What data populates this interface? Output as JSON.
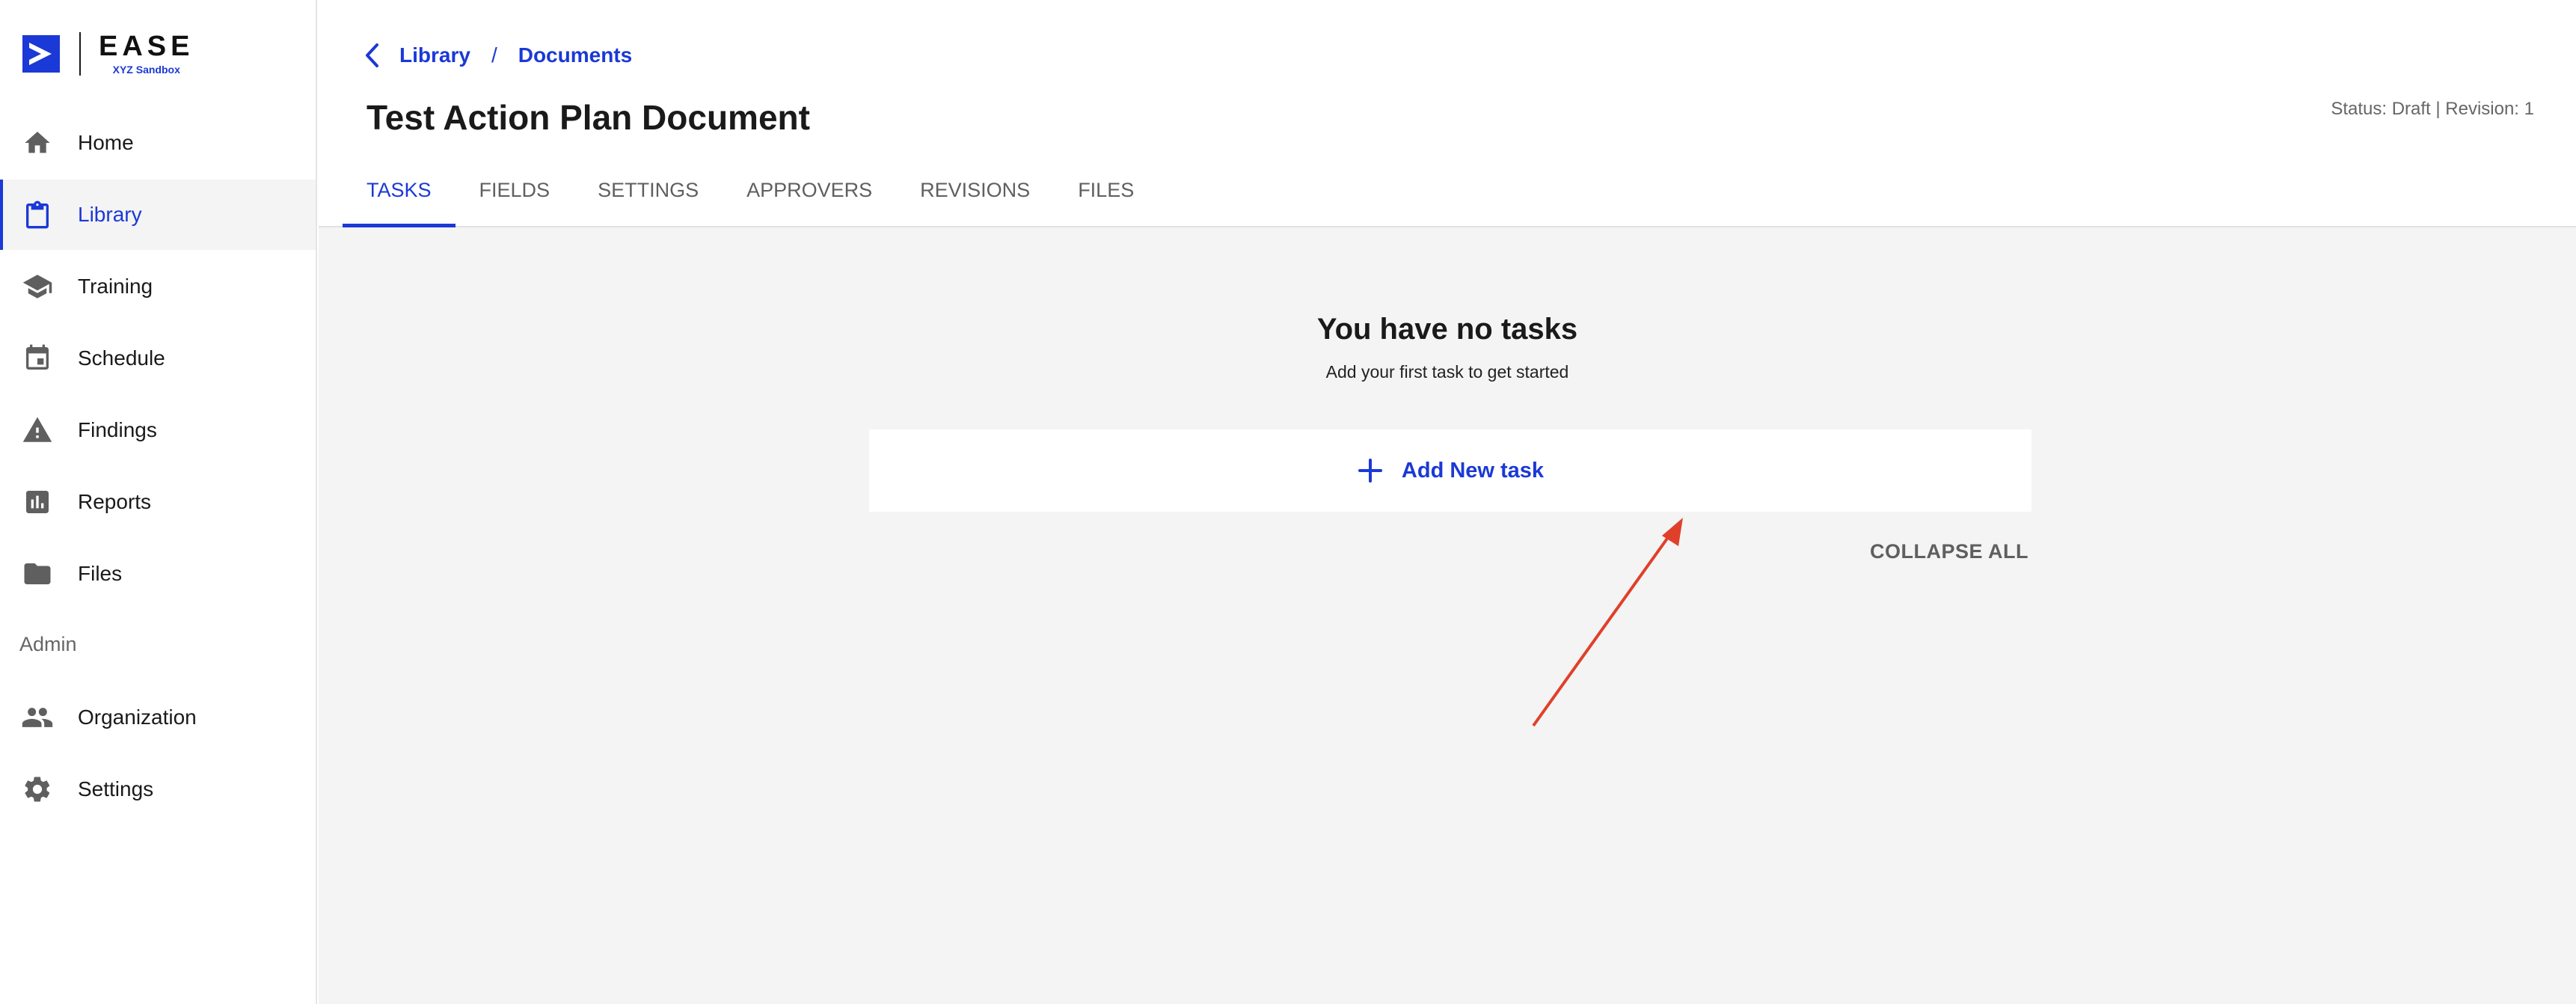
{
  "brand": {
    "word": "EASE",
    "sub": "XYZ Sandbox",
    "accent": "#1b39d6"
  },
  "sidebar": {
    "items": [
      {
        "label": "Home",
        "icon": "home-icon"
      },
      {
        "label": "Library",
        "icon": "clipboard-icon",
        "active": true
      },
      {
        "label": "Training",
        "icon": "graduation-cap-icon"
      },
      {
        "label": "Schedule",
        "icon": "calendar-icon"
      },
      {
        "label": "Findings",
        "icon": "warning-icon"
      },
      {
        "label": "Reports",
        "icon": "bar-chart-icon"
      },
      {
        "label": "Files",
        "icon": "folder-icon"
      }
    ],
    "admin_section": "Admin",
    "admin_items": [
      {
        "label": "Organization",
        "icon": "people-icon"
      },
      {
        "label": "Settings",
        "icon": "gear-icon"
      }
    ]
  },
  "header": {
    "breadcrumb": [
      "Library",
      "Documents"
    ],
    "title": "Test Action Plan Document",
    "status": "Status: Draft | Revision: 1",
    "tabs": [
      {
        "label": "TASKS",
        "active": true
      },
      {
        "label": "FIELDS"
      },
      {
        "label": "SETTINGS"
      },
      {
        "label": "APPROVERS"
      },
      {
        "label": "REVISIONS"
      },
      {
        "label": "FILES"
      }
    ]
  },
  "main": {
    "empty_title": "You have no tasks",
    "empty_subtitle": "Add your first task to get started",
    "add_task_label": "Add New task",
    "collapse_all_label": "COLLAPSE ALL"
  },
  "annotation": {
    "arrow_color": "#e0402a"
  }
}
